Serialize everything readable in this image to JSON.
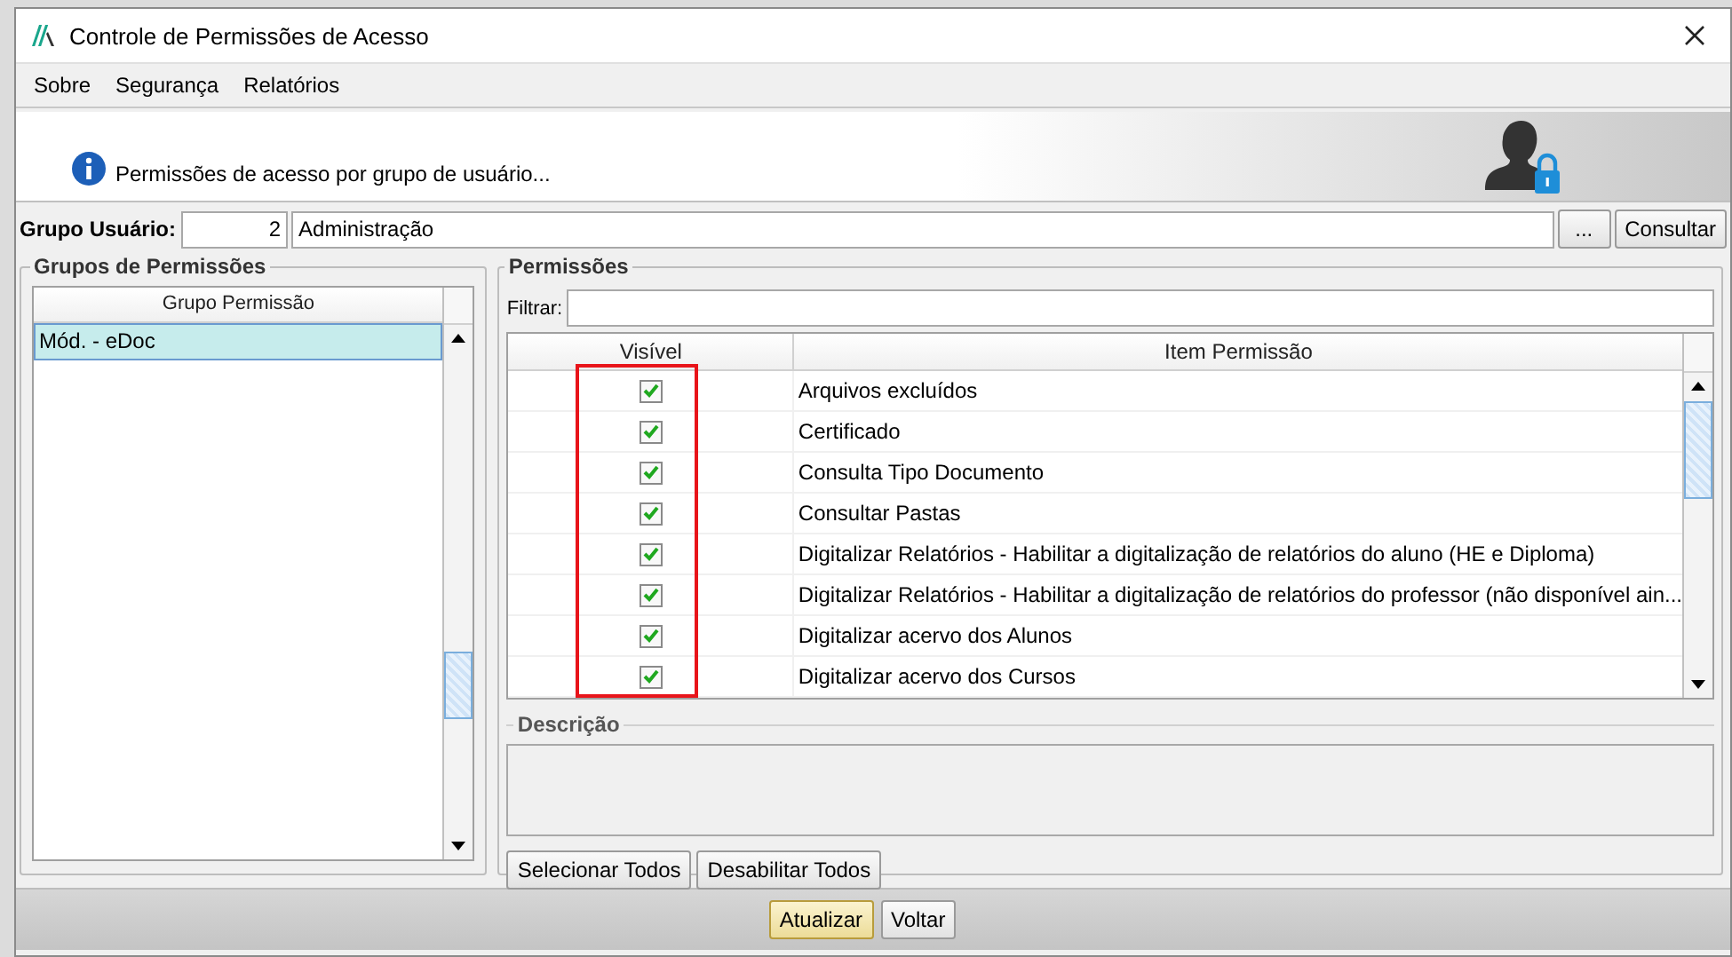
{
  "window": {
    "title": "Controle de Permissões de Acesso"
  },
  "menu": [
    {
      "label": "Sobre"
    },
    {
      "label": "Segurança"
    },
    {
      "label": "Relatórios"
    }
  ],
  "header": {
    "info": "Permissões de acesso por grupo de usuário..."
  },
  "user_group": {
    "label": "Grupo Usuário:",
    "code": "2",
    "name": "Administração",
    "browse": "...",
    "consult": "Consultar"
  },
  "groups": {
    "title": "Grupos de Permissões",
    "column": "Grupo Permissão",
    "rows": [
      {
        "label": "Mód. - eDoc",
        "selected": true
      }
    ]
  },
  "permissions": {
    "title": "Permissões",
    "filter_label": "Filtrar:",
    "columns": [
      "Visível",
      "Item Permissão"
    ],
    "rows": [
      {
        "visible": true,
        "item": "Arquivos excluídos"
      },
      {
        "visible": true,
        "item": "Certificado"
      },
      {
        "visible": true,
        "item": "Consulta Tipo Documento"
      },
      {
        "visible": true,
        "item": "Consultar Pastas"
      },
      {
        "visible": true,
        "item": "Digitalizar Relatórios - Habilitar a digitalização de relatórios do aluno (HE e Diploma)"
      },
      {
        "visible": true,
        "item": "Digitalizar Relatórios - Habilitar a digitalização de relatórios do professor (não disponível ain..."
      },
      {
        "visible": true,
        "item": "Digitalizar acervo dos Alunos"
      },
      {
        "visible": true,
        "item": "Digitalizar acervo dos Cursos"
      }
    ]
  },
  "description": {
    "title": "Descrição"
  },
  "buttons": [
    {
      "label": "Selecionar Todos"
    },
    {
      "label": "Desabilitar Todos"
    }
  ],
  "footer_buttons": [
    {
      "label": "Atualizar",
      "default": true
    },
    {
      "label": "Voltar",
      "default": false
    }
  ]
}
